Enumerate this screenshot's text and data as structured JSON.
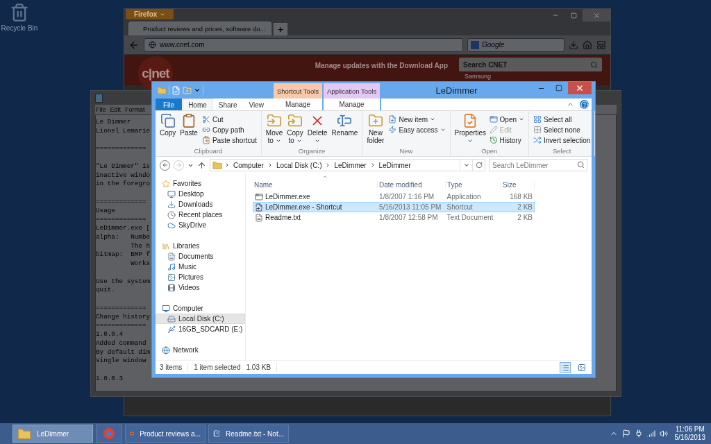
{
  "desktop_icons": [
    {
      "label": "Recycle Bin"
    }
  ],
  "firefox": {
    "menu_button": "Firefox",
    "tabs": [
      {
        "label": "Product reviews and prices, software do...",
        "selected": true
      }
    ],
    "new_tab": "+",
    "url": "www.cnet.com",
    "search_placeholder": "Google",
    "page": {
      "logo": "c|net",
      "promo": "Manage updates with the Download App",
      "search_placeholder": "Search CNET",
      "side_link": "Samsung"
    }
  },
  "notepad": {
    "menu": [
      "File",
      "Edit",
      "Format"
    ],
    "paragraphs": [
      [
        "Le Dimmer",
        "Lionel Lemarie"
      ],
      [
        "============="
      ],
      [
        "\"Le Dimmer\" is",
        "inactive windo",
        "in the foregro"
      ],
      [
        "=============",
        "Usage",
        "=============",
        "LeDimmer.exe [",
        "alpha:   Numbe",
        "         The h",
        "bitmap:  BMP f",
        "         Works"
      ],
      [
        "Use the system",
        "quit."
      ],
      [
        "=============",
        "Change history",
        "=============",
        "1.0.0.4",
        "Added command",
        "By default dim",
        "single window"
      ],
      [
        "1.0.0.3"
      ]
    ]
  },
  "explorer": {
    "title": "LeDimmer",
    "tabs": [
      {
        "label": "File",
        "kind": "file",
        "selected": false
      },
      {
        "label": "Home",
        "kind": "plain",
        "selected": true
      },
      {
        "label": "Share",
        "kind": "plain",
        "selected": false
      },
      {
        "label": "View",
        "kind": "plain",
        "selected": false
      }
    ],
    "context_tabs": [
      {
        "label": "Shortcut Tools",
        "color": "#f9c8aa",
        "tab": {
          "label": "Manage",
          "selected": false
        }
      },
      {
        "label": "Application Tools",
        "color": "#e3c8f6",
        "tab": {
          "label": "Manage",
          "selected": false
        }
      }
    ],
    "ribbon": [
      {
        "label": "Clipboard",
        "items": [
          {
            "label": "Copy",
            "kind": "copy",
            "dropdown": false,
            "disabled": false
          },
          {
            "label": "Paste",
            "kind": "paste",
            "dropdown": false,
            "disabled": false
          },
          {
            "label": "Cut",
            "kind": "cut",
            "dropdown": false,
            "disabled": false
          },
          {
            "label": "Copy path",
            "kind": "path",
            "dropdown": false,
            "disabled": false
          },
          {
            "label": "Paste shortcut",
            "kind": "pasteshortcut",
            "dropdown": false,
            "disabled": false
          }
        ]
      },
      {
        "label": "Organize",
        "items": [
          {
            "label": "Move to",
            "kind": "move",
            "dropdown": true,
            "disabled": false
          },
          {
            "label": "Copy to",
            "kind": "copyto",
            "dropdown": true,
            "disabled": false
          },
          {
            "label": "Delete",
            "kind": "delete",
            "dropdown": true,
            "disabled": false
          },
          {
            "label": "Rename",
            "kind": "rename",
            "dropdown": false,
            "disabled": false
          }
        ]
      },
      {
        "label": "New",
        "items": [
          {
            "label": "New folder",
            "kind": "newfolder",
            "dropdown": false,
            "disabled": false
          },
          {
            "label": "New item",
            "kind": "newitem",
            "dropdown": true,
            "disabled": false
          },
          {
            "label": "Easy access",
            "kind": "easy",
            "dropdown": true,
            "disabled": false
          }
        ]
      },
      {
        "label": "Open",
        "items": [
          {
            "label": "Properties",
            "kind": "properties",
            "dropdown": true,
            "disabled": false
          },
          {
            "label": "Open",
            "kind": "open",
            "dropdown": true,
            "disabled": false
          },
          {
            "label": "Edit",
            "kind": "edit",
            "dropdown": false,
            "disabled": true
          },
          {
            "label": "History",
            "kind": "history",
            "dropdown": false,
            "disabled": false
          }
        ]
      },
      {
        "label": "Select",
        "items": [
          {
            "label": "Select all",
            "kind": "selectall",
            "dropdown": false,
            "disabled": false
          },
          {
            "label": "Select none",
            "kind": "selectnone",
            "dropdown": false,
            "disabled": false
          },
          {
            "label": "Invert selection",
            "kind": "invert",
            "dropdown": false,
            "disabled": false
          }
        ]
      }
    ],
    "address": {
      "path": [
        "Computer",
        "Local Disk (C:)",
        "LeDimmer",
        "LeDimmer"
      ],
      "search_placeholder": "Search LeDimmer"
    },
    "navigation": [
      {
        "label": "Favorites",
        "kind": "star",
        "selected": false,
        "children": [
          {
            "label": "Desktop",
            "kind": "desktop",
            "selected": false
          },
          {
            "label": "Downloads",
            "kind": "downloads",
            "selected": false
          },
          {
            "label": "Recent places",
            "kind": "recent",
            "selected": false
          },
          {
            "label": "SkyDrive",
            "kind": "cloud",
            "selected": false
          }
        ]
      },
      {
        "label": "Libraries",
        "kind": "library",
        "selected": false,
        "children": [
          {
            "label": "Documents",
            "kind": "document",
            "selected": false
          },
          {
            "label": "Music",
            "kind": "music",
            "selected": false
          },
          {
            "label": "Pictures",
            "kind": "pictures",
            "selected": false
          },
          {
            "label": "Videos",
            "kind": "videos",
            "selected": false
          }
        ]
      },
      {
        "label": "Computer",
        "kind": "computer",
        "selected": false,
        "children": [
          {
            "label": "Local Disk (C:)",
            "kind": "disk",
            "selected": true
          },
          {
            "label": "16GB_SDCARD (E:)",
            "kind": "drive",
            "selected": false
          }
        ]
      },
      {
        "label": "Network",
        "kind": "network",
        "selected": false
      }
    ],
    "columns": [
      "Name",
      "Date modified",
      "Type",
      "Size"
    ],
    "files": [
      {
        "kind": "app",
        "name": "LeDimmer.exe",
        "date": "1/8/2007 1:16 PM",
        "type": "Application",
        "size": "168 KB",
        "selected": false
      },
      {
        "kind": "shortcut",
        "name": "LeDimmer.exe - Shortcut",
        "date": "5/16/2013 11:05 PM",
        "type": "Shortcut",
        "size": "2 KB",
        "selected": true
      },
      {
        "kind": "text",
        "name": "Readme.txt",
        "date": "1/8/2007 12:58 PM",
        "type": "Text Document",
        "size": "2 KB",
        "selected": false
      }
    ],
    "status": {
      "count": "3 items",
      "selection": "1 item selected",
      "size": "1.03 KB"
    },
    "views": [
      {
        "kind": "details",
        "selected": true
      },
      {
        "kind": "large",
        "selected": false
      }
    ]
  },
  "taskbar": {
    "items": [
      {
        "kind": "folder",
        "label": "LeDimmer",
        "selected": true
      },
      {
        "kind": "chrome",
        "selected": false
      },
      {
        "kind": "firefox",
        "label": "Product reviews a...",
        "selected": false
      },
      {
        "kind": "notepad",
        "label": "Readme.txt - Not...",
        "selected": false
      }
    ]
  },
  "tray": {
    "time": "11:06 PM",
    "date": "5/16/2013"
  }
}
